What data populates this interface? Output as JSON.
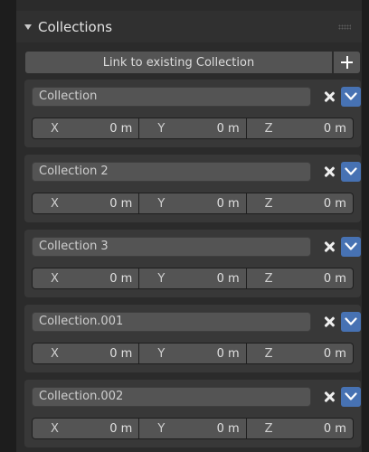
{
  "panel": {
    "title": "Collections",
    "link_button_label": "Link to existing Collection"
  },
  "collections": [
    {
      "name": "Collection",
      "x": "0 m",
      "y": "0 m",
      "z": "0 m"
    },
    {
      "name": "Collection 2",
      "x": "0 m",
      "y": "0 m",
      "z": "0 m"
    },
    {
      "name": "Collection 3",
      "x": "0 m",
      "y": "0 m",
      "z": "0 m"
    },
    {
      "name": "Collection.001",
      "x": "0 m",
      "y": "0 m",
      "z": "0 m"
    },
    {
      "name": "Collection.002",
      "x": "0 m",
      "y": "0 m",
      "z": "0 m"
    }
  ],
  "axis_labels": {
    "x": "X",
    "y": "Y",
    "z": "Z"
  },
  "colors": {
    "accent": "#4772b3",
    "field": "#545454",
    "card": "#383838",
    "panel": "#2b2b2b"
  },
  "icons": {
    "collapse": "triangle-down-icon",
    "grip": "drag-grip-icon",
    "add": "plus-icon",
    "remove": "x-icon",
    "expand": "chevron-down-icon"
  }
}
